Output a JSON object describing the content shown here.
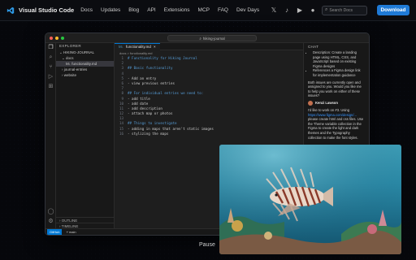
{
  "site": {
    "brand": "Visual Studio Code",
    "nav": [
      "Docs",
      "Updates",
      "Blog",
      "API",
      "Extensions",
      "MCP",
      "FAQ",
      "Dev Days"
    ],
    "search_placeholder": "Search Docs",
    "download_label": "Download",
    "colors": {
      "accent": "#1f7ad6",
      "background": "#06070b"
    }
  },
  "vscode": {
    "command_center": "hiking-journal",
    "explorer": {
      "title": "EXPLORER",
      "tree": [
        {
          "label": "HIKING-JOURNAL",
          "selected": false
        },
        {
          "label": "docs",
          "selected": false
        },
        {
          "label": "functionality.md",
          "selected": true
        },
        {
          "label": "journal-entries",
          "selected": false
        },
        {
          "label": "website",
          "selected": false
        }
      ],
      "footer": [
        "OUTLINE",
        "TIMELINE"
      ]
    },
    "tab_label": "functionality.md",
    "breadcrumb": "docs > functionality.md",
    "code_lines": [
      {
        "n": "1",
        "text": "# Functionality for Hiking Journal",
        "heading": true
      },
      {
        "n": "2",
        "text": "",
        "heading": false
      },
      {
        "n": "3",
        "text": "## Basic functionality",
        "heading": true
      },
      {
        "n": "4",
        "text": "",
        "heading": false
      },
      {
        "n": "5",
        "text": "- Add an entry",
        "heading": false
      },
      {
        "n": "6",
        "text": "- view previous entries",
        "heading": false
      },
      {
        "n": "7",
        "text": "",
        "heading": false
      },
      {
        "n": "8",
        "text": "## For individual entries we need to:",
        "heading": true
      },
      {
        "n": "9",
        "text": "- add title",
        "heading": false
      },
      {
        "n": "10",
        "text": "- add date",
        "heading": false
      },
      {
        "n": "11",
        "text": "- add description",
        "heading": false
      },
      {
        "n": "12",
        "text": "- attach map or photos",
        "heading": false
      },
      {
        "n": "13",
        "text": "",
        "heading": false
      },
      {
        "n": "14",
        "text": "## Things to investigate",
        "heading": true
      },
      {
        "n": "15",
        "text": "- adding in maps that aren't static images",
        "heading": false
      },
      {
        "n": "16",
        "text": "- stylizing the maps",
        "heading": false
      }
    ],
    "chat": {
      "title": "CHAT",
      "bullets": [
        "Description: Create a landing page using HTML, CSS, and JavaScript based on existing Figma designs",
        "References a Figma design link for implementation guidance"
      ],
      "summary": "Both issues are currently open and assigned to you. Would you like me to help you work on either of these issues?",
      "user_name": "Kenzi Lawson",
      "message_start": "I'd like to work on #3. Using",
      "message_link": "https://www.figma.com/design/...",
      "message_end": "please create html and css files. Use the Theme variable collection in the Figma to create the light and dark themes and the Typography collection to make the font styles."
    },
    "status": {
      "remote": "GitHub",
      "branch": "main"
    }
  },
  "video": {
    "caption": "Pause"
  }
}
